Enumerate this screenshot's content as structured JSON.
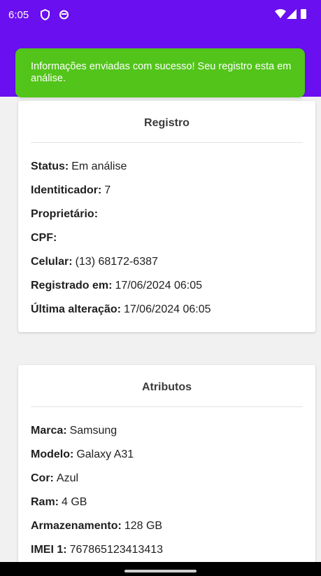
{
  "status_bar": {
    "time": "6:05",
    "icons": [
      "shield-icon",
      "circle-icon",
      "wifi-icon",
      "signal-icon",
      "battery-icon"
    ]
  },
  "colors": {
    "app_bar": "#6a0ff0",
    "toast": "#52c41a",
    "card_bg": "#ffffff",
    "page_bg": "#f1f1f1"
  },
  "toast": {
    "message": "Informações enviadas com sucesso! Seu registro esta em análise."
  },
  "registro": {
    "title": "Registro",
    "fields": [
      {
        "label": "Status:",
        "value": "Em análise"
      },
      {
        "label": "Identiticador:",
        "value": "7"
      },
      {
        "label": "Proprietário:",
        "value": ""
      },
      {
        "label": "CPF:",
        "value": ""
      },
      {
        "label": "Celular:",
        "value": "(13) 68172-6387"
      },
      {
        "label": "Registrado em:",
        "value": "17/06/2024 06:05"
      },
      {
        "label": "Última alteração:",
        "value": "17/06/2024 06:05"
      }
    ]
  },
  "atributos": {
    "title": "Atributos",
    "fields": [
      {
        "label": "Marca:",
        "value": "Samsung"
      },
      {
        "label": "Modelo:",
        "value": "Galaxy A31"
      },
      {
        "label": "Cor:",
        "value": "Azul"
      },
      {
        "label": "Ram:",
        "value": "4 GB"
      },
      {
        "label": "Armazenamento:",
        "value": "128 GB"
      },
      {
        "label": "IMEI 1:",
        "value": "767865123413413"
      }
    ]
  }
}
